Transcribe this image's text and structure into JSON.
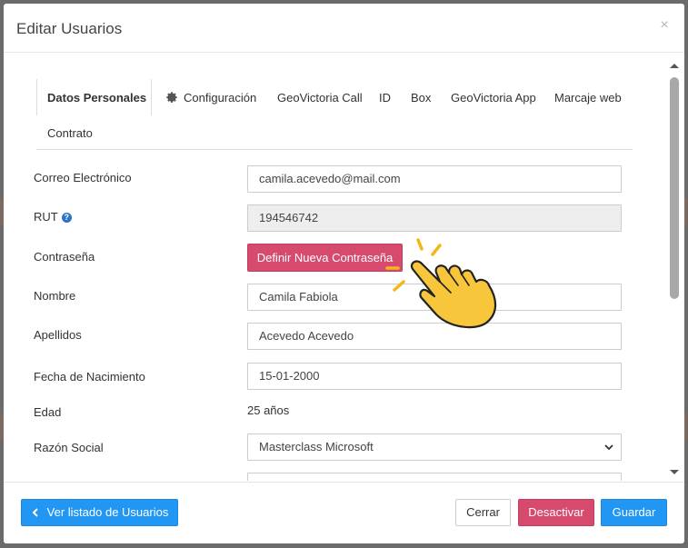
{
  "modal": {
    "title": "Editar Usuarios",
    "close_glyph": "×"
  },
  "tabs": [
    {
      "label": "Datos Personales",
      "active": true
    },
    {
      "label": "Configuración",
      "icon": "gear-icon"
    },
    {
      "label": "GeoVictoria Call"
    },
    {
      "label": "ID"
    },
    {
      "label": "Box"
    },
    {
      "label": "GeoVictoria App"
    },
    {
      "label": "Marcaje web"
    },
    {
      "label": "Contrato"
    }
  ],
  "form": {
    "email": {
      "label": "Correo Electrónico",
      "value": "camila.acevedo@mail.com"
    },
    "rut": {
      "label": "RUT",
      "value": "194546742",
      "help_glyph": "?"
    },
    "password": {
      "label": "Contraseña",
      "button_label": "Definir Nueva Contraseña"
    },
    "first_name": {
      "label": "Nombre",
      "value": "Camila Fabiola"
    },
    "last_name": {
      "label": "Apellidos",
      "value": "Acevedo Acevedo"
    },
    "birthdate": {
      "label": "Fecha de Nacimiento",
      "value": "15-01-2000"
    },
    "age": {
      "label": "Edad",
      "value": "25 años"
    },
    "company": {
      "label": "Razón Social",
      "value": "Masterclass Microsoft"
    }
  },
  "footer": {
    "back_label": "Ver listado de Usuarios",
    "close_label": "Cerrar",
    "deactivate_label": "Desactivar",
    "save_label": "Guardar"
  },
  "colors": {
    "primary": "#2196f3",
    "danger": "#d64a6d",
    "pointer_hand": "#f8c63a"
  }
}
